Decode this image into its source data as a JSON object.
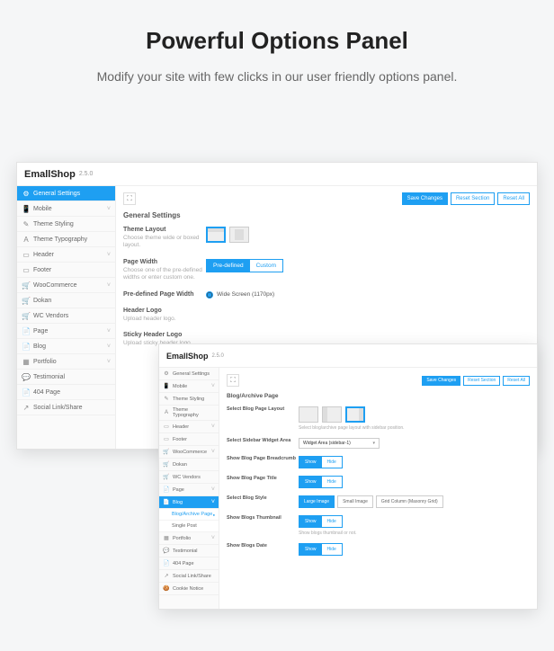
{
  "hero": {
    "title": "Powerful Options Panel",
    "subtitle": "Modify your site with few clicks in our user friendly options panel."
  },
  "brand": "EmallShop",
  "version": "2.5.0",
  "buttons": {
    "save": "Save Changes",
    "reset_section": "Reset Section",
    "reset_all": "Reset All"
  },
  "panel1": {
    "nav": [
      {
        "icon": "⚙",
        "label": "General Settings",
        "active": true,
        "chev": ""
      },
      {
        "icon": "📱",
        "label": "Mobile",
        "chev": "˅"
      },
      {
        "icon": "✎",
        "label": "Theme Styling",
        "chev": ""
      },
      {
        "icon": "A",
        "label": "Theme Typography",
        "chev": ""
      },
      {
        "icon": "▭",
        "label": "Header",
        "chev": "˅"
      },
      {
        "icon": "▭",
        "label": "Footer",
        "chev": ""
      },
      {
        "icon": "🛒",
        "label": "WooCommerce",
        "chev": "˅"
      },
      {
        "icon": "🛒",
        "label": "Dokan",
        "chev": ""
      },
      {
        "icon": "🛒",
        "label": "WC Vendors",
        "chev": ""
      },
      {
        "icon": "📄",
        "label": "Page",
        "chev": "˅"
      },
      {
        "icon": "📄",
        "label": "Blog",
        "chev": "˅"
      },
      {
        "icon": "▦",
        "label": "Portfolio",
        "chev": "˅"
      },
      {
        "icon": "💬",
        "label": "Testimonial",
        "chev": ""
      },
      {
        "icon": "📄",
        "label": "404 Page",
        "chev": ""
      },
      {
        "icon": "↗",
        "label": "Social Link/Share",
        "chev": ""
      }
    ],
    "section": "General Settings",
    "rows": {
      "theme_layout": {
        "t": "Theme Layout",
        "d": "Choose theme wide or boxed layout."
      },
      "page_width": {
        "t": "Page Width",
        "d": "Choose one of the pre-defined widths or enter custom one.",
        "opts": [
          "Pre-defined",
          "Custom"
        ]
      },
      "predef_width": {
        "t": "Pre-defined Page Width",
        "radio": "Wide Screen (1170px)"
      },
      "header_logo": {
        "t": "Header Logo",
        "d": "Upload header logo."
      },
      "sticky_logo": {
        "t": "Sticky Header Logo",
        "d": "Upload sticky header logo."
      }
    }
  },
  "panel2": {
    "nav": [
      {
        "icon": "⚙",
        "label": "General Settings"
      },
      {
        "icon": "📱",
        "label": "Mobile",
        "chev": "˅"
      },
      {
        "icon": "✎",
        "label": "Theme Styling"
      },
      {
        "icon": "A",
        "label": "Theme Typography"
      },
      {
        "icon": "▭",
        "label": "Header",
        "chev": "˅"
      },
      {
        "icon": "▭",
        "label": "Footer"
      },
      {
        "icon": "🛒",
        "label": "WooCommerce",
        "chev": "˅"
      },
      {
        "icon": "🛒",
        "label": "Dokan"
      },
      {
        "icon": "🛒",
        "label": "WC Vendors"
      },
      {
        "icon": "📄",
        "label": "Page",
        "chev": "˅"
      },
      {
        "icon": "📄",
        "label": "Blog",
        "active": true,
        "chev": "˅"
      }
    ],
    "subnav": [
      {
        "label": "Blog/Archive Page",
        "active": true
      },
      {
        "label": "Single Post"
      }
    ],
    "nav2": [
      {
        "icon": "▦",
        "label": "Portfolio",
        "chev": "˅"
      },
      {
        "icon": "💬",
        "label": "Testimonial"
      },
      {
        "icon": "📄",
        "label": "404 Page"
      },
      {
        "icon": "↗",
        "label": "Social Link/Share"
      },
      {
        "icon": "🍪",
        "label": "Cookie Notice"
      }
    ],
    "section": "Blog/Archive Page",
    "rows": {
      "layout": {
        "t": "Select Blog Page Layout",
        "hint": "Select blog/archive page layout with sidebar position."
      },
      "sidebar": {
        "t": "Select Sidebar Widget Area",
        "sel": "Widget Area (sidebar-1)"
      },
      "breadcrumb": {
        "t": "Show Blog Page Breadcrumb",
        "opts": [
          "Show",
          "Hide"
        ]
      },
      "title": {
        "t": "Show Blog Page Title",
        "opts": [
          "Show",
          "Hide"
        ]
      },
      "style": {
        "t": "Select Blog Style",
        "chips": [
          "Large Image",
          "Small Image",
          "Grid Column (Masonry Grid)"
        ]
      },
      "thumb": {
        "t": "Show Blogs Thumbnail",
        "opts": [
          "Show",
          "Hide"
        ],
        "hint": "Show blogs thumbnail or not."
      },
      "date": {
        "t": "Show Blogs Date",
        "opts": [
          "Show",
          "Hide"
        ]
      }
    }
  }
}
